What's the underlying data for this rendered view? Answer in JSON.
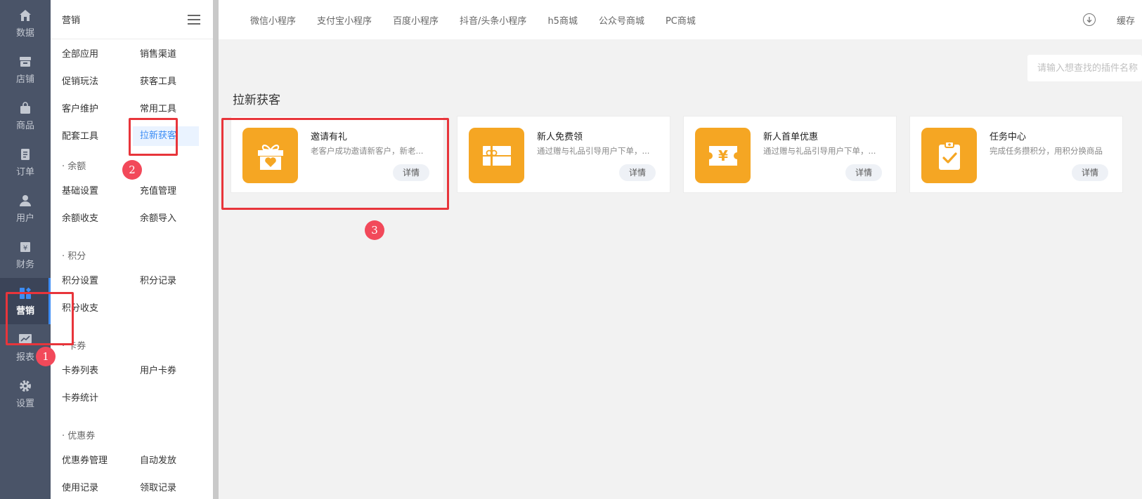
{
  "rail": [
    {
      "label": "数据",
      "icon": "home-icon"
    },
    {
      "label": "店铺",
      "icon": "store-icon"
    },
    {
      "label": "商品",
      "icon": "bag-icon"
    },
    {
      "label": "订单",
      "icon": "order-icon"
    },
    {
      "label": "用户",
      "icon": "user-icon"
    },
    {
      "label": "财务",
      "icon": "finance-icon"
    },
    {
      "label": "营销",
      "icon": "apps-icon",
      "active": true
    },
    {
      "label": "报表",
      "icon": "chart-icon"
    },
    {
      "label": "设置",
      "icon": "gear-icon"
    }
  ],
  "submenu": {
    "title": "营销",
    "items": [
      "全部应用",
      "销售渠道",
      "促销玩法",
      "获客工具",
      "客户维护",
      "常用工具",
      "配套工具",
      "拉新获客",
      "基础设置",
      "充值管理",
      "余额收支",
      "余额导入",
      "积分设置",
      "积分记录",
      "积分收支",
      "卡券列表",
      "用户卡券",
      "卡券统计",
      "优惠券管理",
      "自动发放",
      "使用记录",
      "领取记录"
    ],
    "sections": [
      "· 余额",
      "· 积分",
      "· 卡券",
      "· 优惠券"
    ]
  },
  "topbar": {
    "tabs": [
      "微信小程序",
      "支付宝小程序",
      "百度小程序",
      "抖音/头条小程序",
      "h5商城",
      "公众号商城",
      "PC商城"
    ],
    "cache_label": "缓存"
  },
  "search": {
    "placeholder": "请输入想查找的插件名称"
  },
  "section_title": "拉新获客",
  "cards": [
    {
      "title": "邀请有礼",
      "desc": "老客户成功邀请新客户，新老...",
      "button": "详情",
      "icon": "gift-icon"
    },
    {
      "title": "新人免费领",
      "desc": "通过赠与礼品引导用户下单，...",
      "button": "详情",
      "icon": "giftcard-icon"
    },
    {
      "title": "新人首单优惠",
      "desc": "通过赠与礼品引导用户下单，...",
      "button": "详情",
      "icon": "yen-ticket-icon"
    },
    {
      "title": "任务中心",
      "desc": "完成任务攒积分，用积分换商品",
      "button": "详情",
      "icon": "clipboard-check-icon"
    }
  ],
  "annotations": [
    "1",
    "2",
    "3"
  ],
  "colors": {
    "accent": "#3d8df5",
    "card_icon": "#f5a623",
    "annotation": "#e8353b"
  }
}
